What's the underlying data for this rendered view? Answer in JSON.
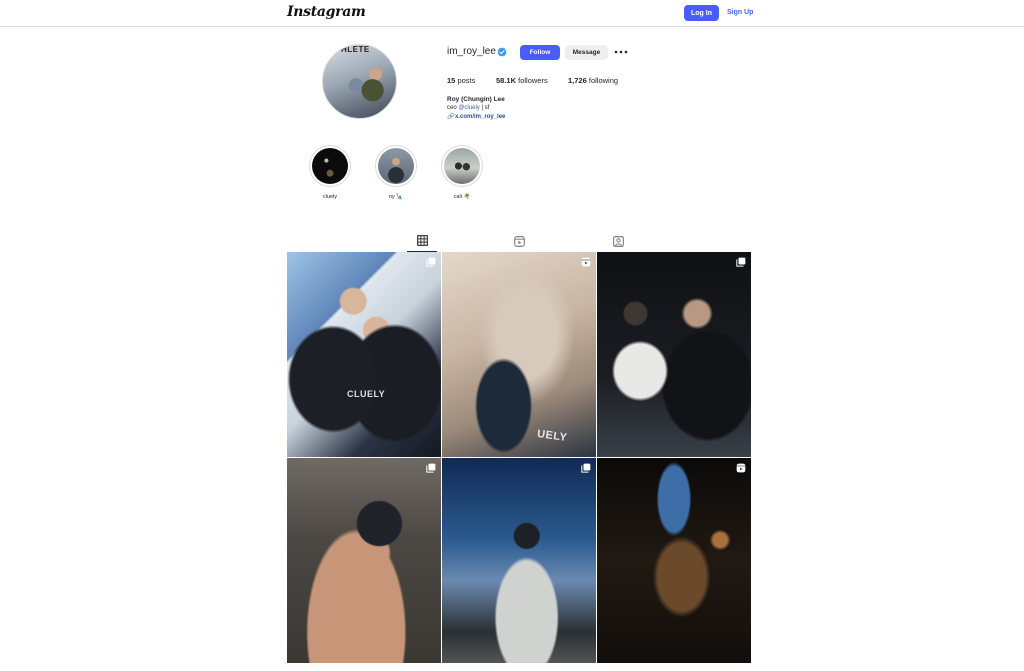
{
  "nav": {
    "logo": "Instagram",
    "login_label": "Log In",
    "signup_label": "Sign Up"
  },
  "profile": {
    "username": "im_roy_lee",
    "verified": true,
    "follow_label": "Follow",
    "message_label": "Message",
    "more_icon": "more-horizontal-icon",
    "stats": {
      "posts_count": "15",
      "posts_label": "posts",
      "followers_count": "58.1K",
      "followers_label": "followers",
      "following_count": "1,726",
      "following_label": "following"
    },
    "full_name": "Roy (Chungin) Lee",
    "bio_prefix": "ceo ",
    "bio_mention": "@cluely",
    "bio_suffix": " | sf",
    "link_icon": "link-icon",
    "link": "x.com/im_roy_lee",
    "avatar_sign_text": "HLETE"
  },
  "highlights": [
    {
      "label": "cluely"
    },
    {
      "label": "ny 🗽"
    },
    {
      "label": "cali 🌴"
    }
  ],
  "tabs": [
    {
      "name": "posts",
      "icon": "grid-icon",
      "active": true
    },
    {
      "name": "reels",
      "icon": "reels-icon",
      "active": false
    },
    {
      "name": "tagged",
      "icon": "tagged-icon",
      "active": false
    }
  ],
  "posts": [
    {
      "type": "carousel",
      "icon": "carousel-icon",
      "overlay_text": "CLUELY"
    },
    {
      "type": "reel",
      "icon": "reels-icon",
      "overlay_text": "UELY"
    },
    {
      "type": "carousel",
      "icon": "carousel-icon",
      "overlay_text": ""
    },
    {
      "type": "carousel",
      "icon": "carousel-icon",
      "overlay_text": ""
    },
    {
      "type": "carousel",
      "icon": "carousel-icon",
      "overlay_text": ""
    },
    {
      "type": "reel",
      "icon": "reels-icon",
      "overlay_text": ""
    }
  ],
  "colors": {
    "accent": "#4a5df9",
    "link": "#3f63f0",
    "border": "#dbdbdb",
    "text": "#262626"
  }
}
